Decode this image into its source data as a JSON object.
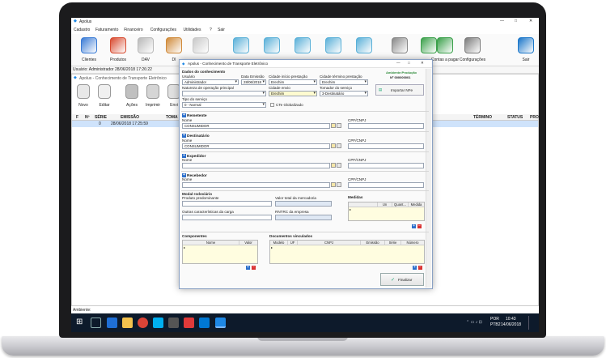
{
  "app": {
    "title": "Apolus",
    "menu": [
      "Cadastro",
      "Faturamento",
      "Financeiro",
      "Configurações",
      "Utilidades",
      "?",
      "Sair"
    ],
    "toolbar": [
      {
        "label": "Clientes",
        "icon": "clients-icon",
        "color": "#3a7bd5"
      },
      {
        "label": "Produtos",
        "icon": "products-icon",
        "color": "#d84a2f"
      },
      {
        "label": "DAV",
        "icon": "dav-icon",
        "color": "#b9b9b9"
      },
      {
        "label": "DI",
        "icon": "di-icon",
        "color": "#d08a3a"
      },
      {
        "label": "",
        "icon": "document-icon",
        "color": "#c8c8c8"
      },
      {
        "label": "",
        "icon": "nfe-icon",
        "color": "#5ab0d8"
      },
      {
        "label": "",
        "icon": "nfe-icon",
        "color": "#5ab0d8"
      },
      {
        "label": "",
        "icon": "nfe-icon",
        "color": "#5ab0d8"
      },
      {
        "label": "",
        "icon": "nfe-icon",
        "color": "#5ab0d8"
      },
      {
        "label": "",
        "icon": "nfe-icon",
        "color": "#5ab0d8"
      },
      {
        "label": "",
        "icon": "cash-register-icon",
        "color": "#888888"
      },
      {
        "label": "",
        "icon": "money-icon",
        "color": "#3aa04a"
      },
      {
        "label": "Contas a pagar",
        "icon": "money-icon",
        "color": "#3aa04a"
      },
      {
        "label": "Configurações",
        "icon": "tools-icon",
        "color": "#7b7b7b"
      },
      {
        "label": "Sair",
        "icon": "exit-icon",
        "color": "#1a76c9"
      }
    ],
    "user_status": "Usuário: Administrador",
    "user_date": "28/06/2018 17:26:22"
  },
  "inner_window": {
    "title": "Apolus - Conhecimento de Transporte Eletrônico",
    "toolbar": [
      {
        "label": "Novo",
        "icon": "new-doc-icon"
      },
      {
        "label": "Editar",
        "icon": "edit-icon"
      },
      {
        "label": "Ações",
        "icon": "actions-icon"
      },
      {
        "label": "Imprimir",
        "icon": "print-icon"
      },
      {
        "label": "Envi",
        "icon": "send-icon"
      }
    ],
    "columns": [
      "F",
      "Nº",
      "SÉRIE",
      "EMISSÃO",
      "TOMA",
      "TÉRMINO",
      "STATUS",
      "PRO"
    ],
    "rows": [
      {
        "f": "",
        "numero": "0",
        "serie": "",
        "emissao": "28/06/2018 17:25:59"
      }
    ]
  },
  "dialog": {
    "title": "Apolus - Conhecimento de Transporte Eletrônico",
    "ambiente": "Ambiente:Produção",
    "numero": "Nº 000000001",
    "importar_button": "Importar NFe",
    "dados_title": "Dados do conhecimento",
    "usuario_label": "Usuário",
    "usuario_value": "Administrador",
    "data_emissao_label": "Data Emissão",
    "data_emissao_value": "28/06/2018",
    "cidade_inicio_label": "Cidade início prestação",
    "cidade_inicio_value": "Erechim",
    "cidade_termino_label": "Cidade término prestação",
    "cidade_termino_value": "Erechim",
    "natureza_label": "Natureza de operação principal",
    "natureza_value": "",
    "cidade_envio_label": "Cidade envio",
    "cidade_envio_value": "Erechim",
    "tomador_label": "Tomador do serviço",
    "tomador_value": "3-Destinatário",
    "tipo_servico_label": "Tipo do serviço",
    "tipo_servico_value": "0 - Normal",
    "cte_globalizado": "CTe Globalizado",
    "remetente_title": "Remetente",
    "destinatario_title": "Destinatário",
    "expedidor_title": "Expedidor",
    "recebedor_title": "Recebedor",
    "nome_label": "Nome",
    "cpf_label": "CPF/CNPJ",
    "remetente_nome": "CONSUMIDOR",
    "destinatario_nome": "CONSUMIDOR",
    "modal_title": "Modal rodoviário",
    "produto_label": "Produto predominante",
    "valor_total_label": "Valor total da mercadoria",
    "outras_label": "Outras características da carga",
    "rntrc_label": "RNTRC da empresa",
    "medidas_title": "Medidas",
    "medidas_cols": [
      "Un",
      "Quant...",
      "Medida"
    ],
    "componentes_title": "Componentes",
    "componentes_cols": [
      "Nome",
      "Valor"
    ],
    "documentos_title": "Documentos vinculados",
    "documentos_cols": [
      "Modelo",
      "UF",
      "CNPJ",
      "Emissão",
      "Série",
      "Número"
    ],
    "finalizar_button": "Finalizar"
  },
  "status_bar": {
    "ambiente": "Ambiente:"
  },
  "taskbar": {
    "lang": "POR",
    "layout": "PTB2",
    "time": "10:43",
    "date": "14/06/2018"
  }
}
